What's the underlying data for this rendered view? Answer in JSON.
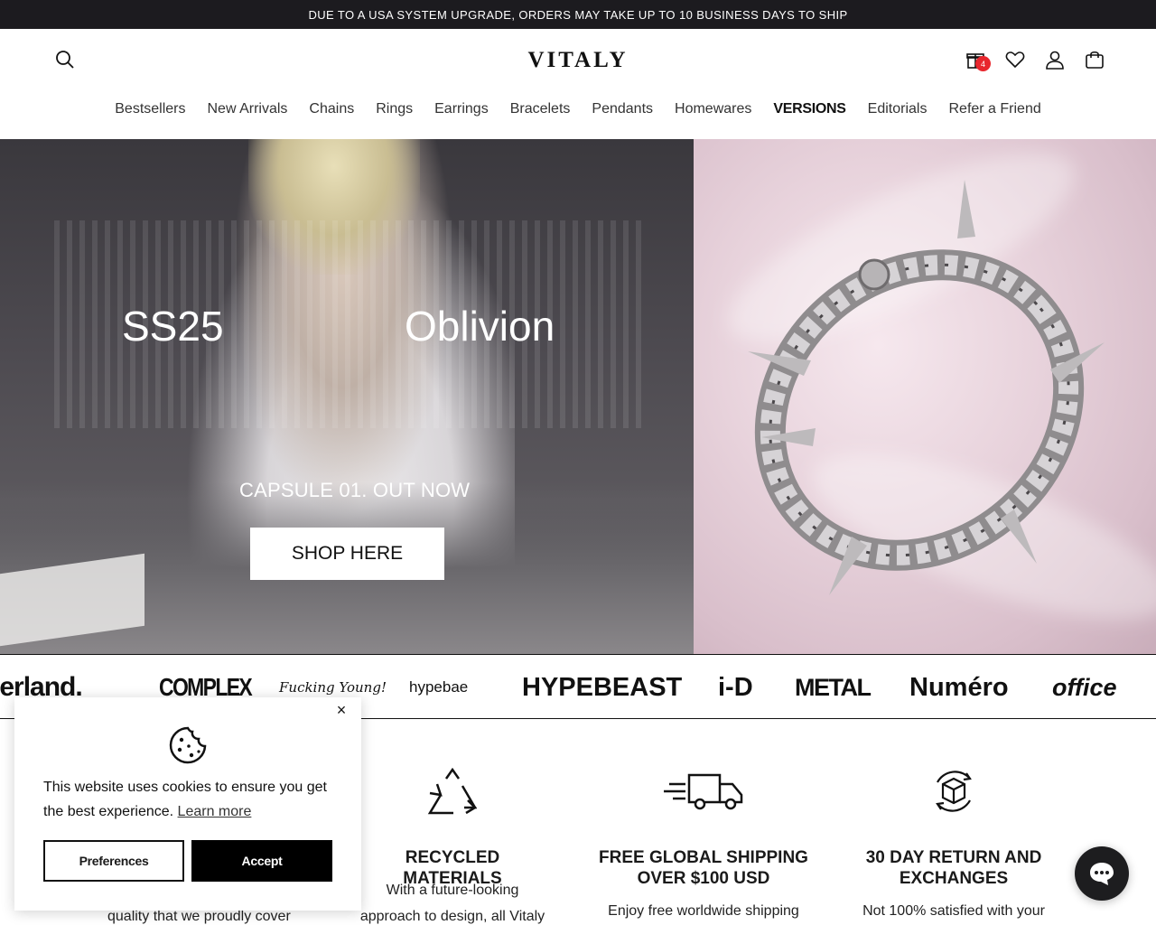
{
  "announcement": {
    "text": "DUE TO A USA SYSTEM UPGRADE, ORDERS MAY TAKE UP TO 10 BUSINESS DAYS TO SHIP"
  },
  "header": {
    "logo": "VITALY",
    "gift_badge_count": "4",
    "icons": [
      "search-icon",
      "gift-icon",
      "heart-icon",
      "account-icon",
      "cart-icon"
    ]
  },
  "nav": {
    "items": [
      "Bestsellers",
      "New Arrivals",
      "Chains",
      "Rings",
      "Earrings",
      "Bracelets",
      "Pendants",
      "Homewares",
      "VERSIONS",
      "Editorials",
      "Refer a Friend"
    ]
  },
  "hero": {
    "season": "SS25",
    "collection": "Oblivion",
    "tagline": "CAPSULE 01. OUT NOW",
    "cta": "SHOP HERE"
  },
  "press": {
    "logos": [
      "lerland.",
      "COMPLEX",
      "Fucking Young!",
      "hypebae",
      "HYPEBEAST",
      "i-D",
      "METAL",
      "Numéro",
      "office"
    ]
  },
  "features": [
    {
      "icon": "recycle-icon",
      "title": "RECYCLED MATERIALS",
      "text": "With a future-looking",
      "text2": "approach to design, all Vitaly"
    },
    {
      "icon": "truck-icon",
      "title": "FREE GLOBAL SHIPPING OVER $100 USD",
      "text": "Enjoy free worldwide shipping"
    },
    {
      "icon": "box-return-icon",
      "title": "30 DAY RETURN AND EXCHANGES",
      "text": "Not 100% satisfied with your"
    }
  ],
  "partial_feature_text": "quality that we proudly cover",
  "cookie": {
    "message": "This website uses cookies to ensure you get the best experience.",
    "learn_more": "Learn more",
    "preferences": "Preferences",
    "accept": "Accept",
    "close": "×"
  },
  "colors": {
    "announce_bg": "#1c1b1f",
    "badge": "#e8262d",
    "accept_bg": "#000000"
  }
}
